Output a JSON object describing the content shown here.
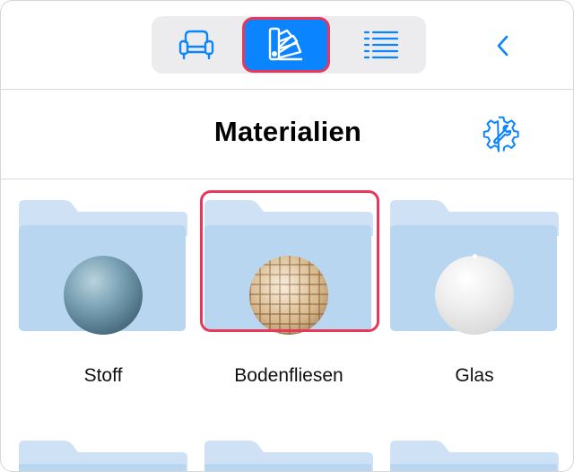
{
  "toolbar": {
    "segments": [
      {
        "name": "furniture",
        "icon": "armchair-icon",
        "selected": false
      },
      {
        "name": "materials",
        "icon": "swatch-fan-icon",
        "selected": true
      },
      {
        "name": "list",
        "icon": "list-icon",
        "selected": false
      }
    ],
    "back_icon": "chevron-left-icon"
  },
  "header": {
    "title": "Materialien",
    "settings_icon": "gear-wrench-icon"
  },
  "folders": [
    {
      "label": "Stoff",
      "material": "fabric",
      "selected": false
    },
    {
      "label": "Bodenfliesen",
      "material": "floor-tiles",
      "selected": true
    },
    {
      "label": "Glas",
      "material": "glass",
      "selected": false
    }
  ],
  "colors": {
    "accent": "#0a84ff",
    "selection": "#e8375b",
    "folder": "#b9d6f0",
    "folder_tab": "#cfe2f5"
  }
}
